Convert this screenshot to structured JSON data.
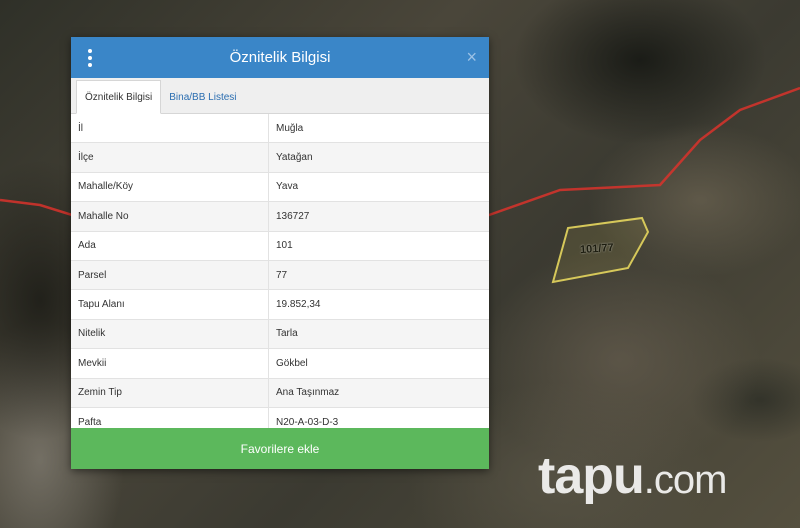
{
  "panel": {
    "title": "Öznitelik Bilgisi",
    "menu_icon": "vertical-dots-icon",
    "close_icon": "close-icon",
    "close_symbol": "×"
  },
  "tabs": [
    {
      "label": "Öznitelik Bilgisi",
      "active": true
    },
    {
      "label": "Bina/BB Listesi",
      "active": false
    }
  ],
  "attributes": [
    {
      "key": "İl",
      "value": "Muğla"
    },
    {
      "key": "İlçe",
      "value": "Yatağan"
    },
    {
      "key": "Mahalle/Köy",
      "value": "Yava"
    },
    {
      "key": "Mahalle No",
      "value": "136727"
    },
    {
      "key": "Ada",
      "value": "101"
    },
    {
      "key": "Parsel",
      "value": "77"
    },
    {
      "key": "Tapu Alanı",
      "value": "19.852,34"
    },
    {
      "key": "Nitelik",
      "value": "Tarla"
    },
    {
      "key": "Mevkii",
      "value": "Gökbel"
    },
    {
      "key": "Zemin Tip",
      "value": "Ana Taşınmaz"
    },
    {
      "key": "Pafta",
      "value": "N20-A-03-D-3"
    }
  ],
  "favorite_button": "Favorilere ekle",
  "map": {
    "parcel_label": "101/77",
    "parcel_color": "#d6c85a",
    "boundary_color": "#d9322c"
  },
  "watermark": {
    "brand": "tapu",
    "dot": ".",
    "tld": "com"
  },
  "colors": {
    "header": "#3a86c8",
    "button": "#5cb85c"
  }
}
